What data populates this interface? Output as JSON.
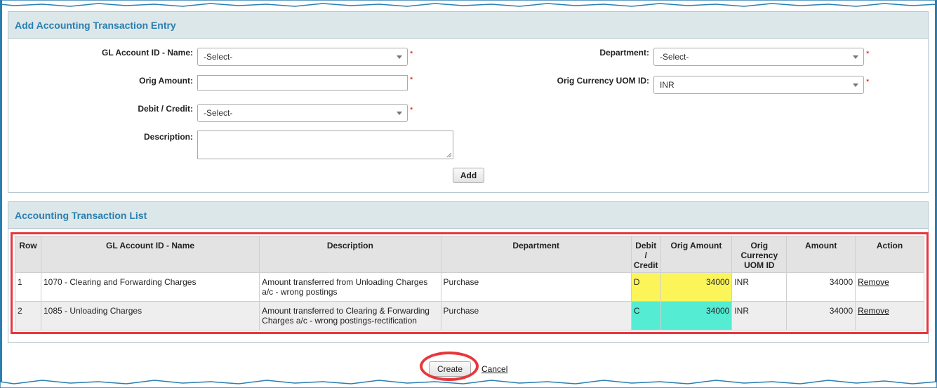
{
  "entry": {
    "title": "Add Accounting Transaction Entry",
    "gl_label": "GL Account ID - Name:",
    "gl_value": "-Select-",
    "orig_amount_label": "Orig Amount:",
    "orig_amount_value": "",
    "debit_credit_label": "Debit / Credit:",
    "debit_credit_value": "-Select-",
    "description_label": "Description:",
    "department_label": "Department:",
    "department_value": "-Select-",
    "currency_label": "Orig Currency UOM ID:",
    "currency_value": "INR",
    "required_mark": "*",
    "add_button": "Add"
  },
  "list": {
    "title": "Accounting Transaction List",
    "headers": [
      "Row",
      "GL Account ID - Name",
      "Description",
      "Department",
      "Debit / Credit",
      "Orig Amount",
      "Orig Currency UOM ID",
      "Amount",
      "Action"
    ],
    "rows": [
      {
        "row": "1",
        "gl": "1070 - Clearing and Forwarding Charges",
        "description": "Amount transferred from Unloading Charges a/c - wrong postings",
        "department": "Purchase",
        "dc": "D",
        "orig_amount": "34000",
        "currency": "INR",
        "amount": "34000",
        "action": "Remove"
      },
      {
        "row": "2",
        "gl": "1085 - Unloading Charges",
        "description": "Amount transferred to Clearing & Forwarding Charges a/c - wrong postings-rectification",
        "department": "Purchase",
        "dc": "C",
        "orig_amount": "34000",
        "currency": "INR",
        "amount": "34000",
        "action": "Remove"
      }
    ]
  },
  "footer": {
    "create": "Create",
    "cancel": "Cancel"
  },
  "colors": {
    "accent": "#2a7fb0",
    "highlight_debit": "#fbf55a",
    "highlight_credit": "#54ecd3",
    "annotation": "#e8373c"
  }
}
